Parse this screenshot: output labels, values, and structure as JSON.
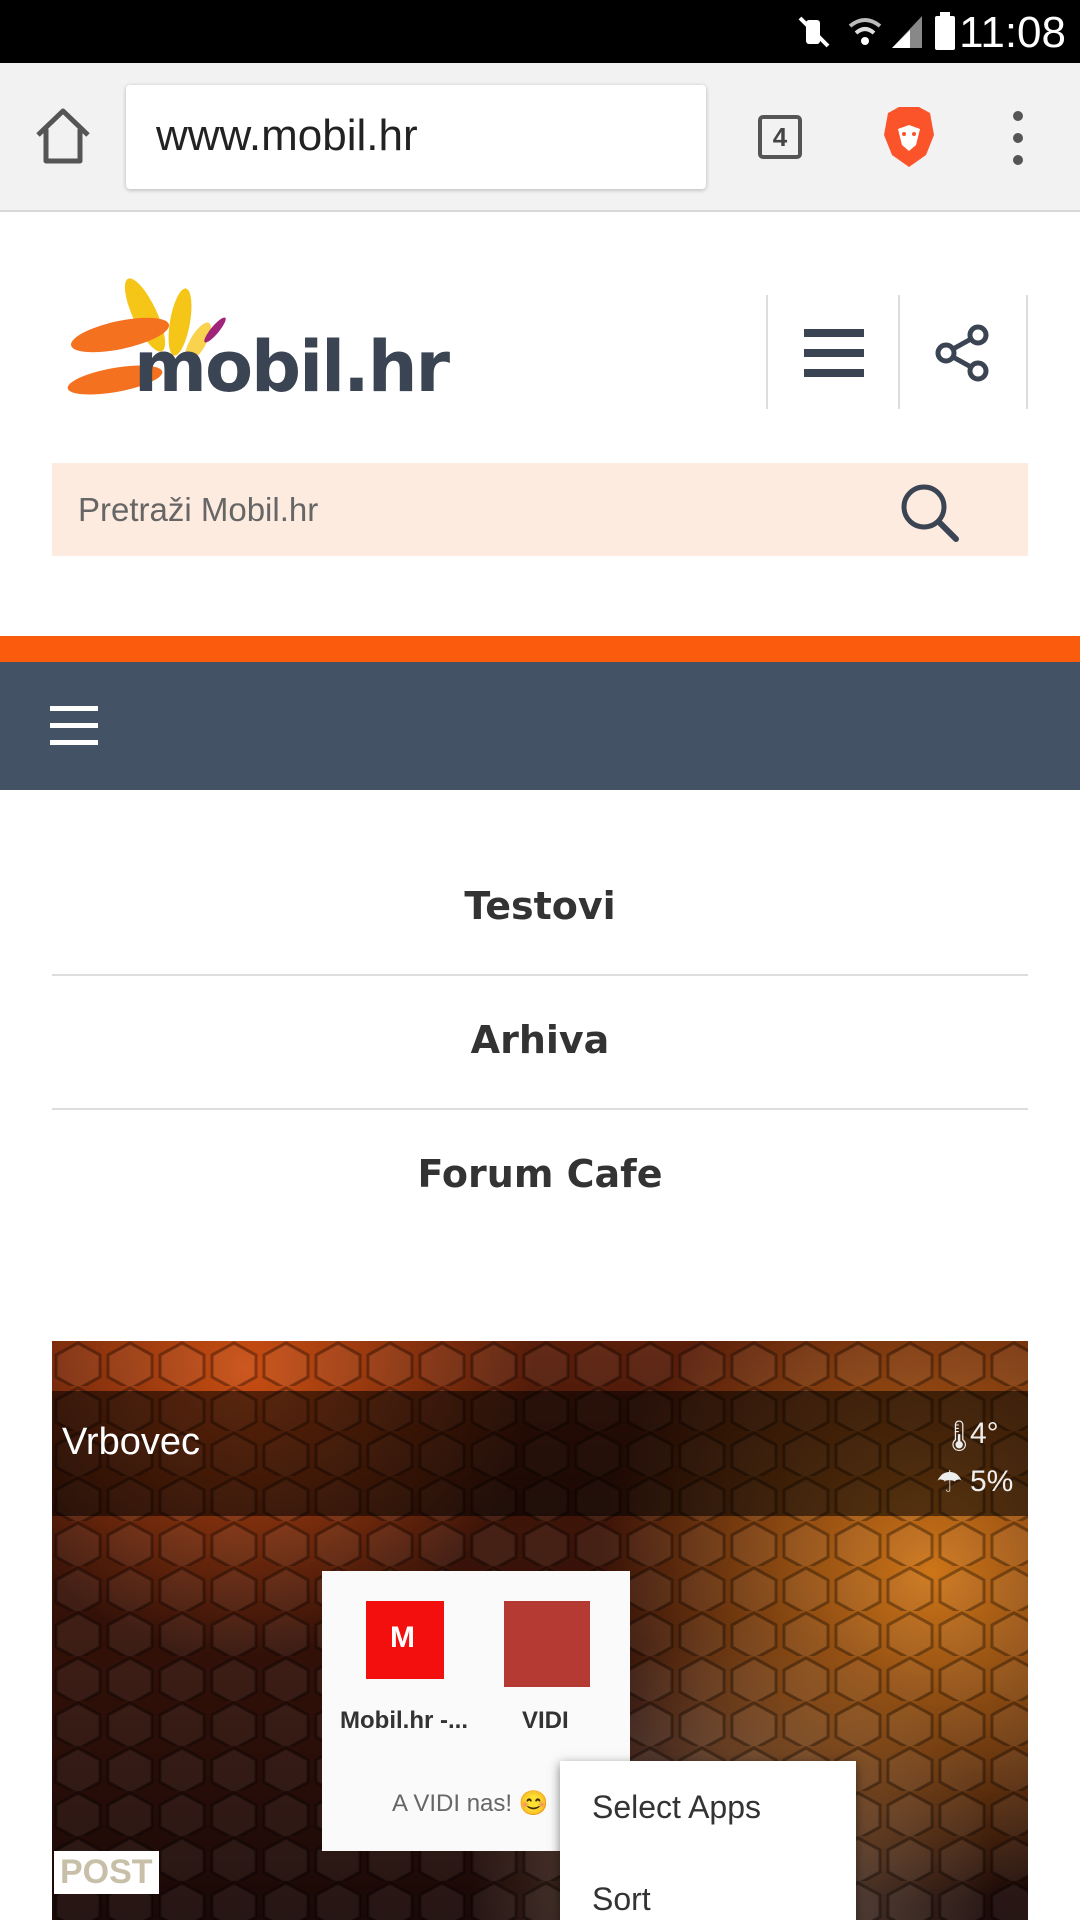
{
  "status_bar": {
    "time": "11:08"
  },
  "browser": {
    "url": "www.mobil.hr",
    "tab_count": "4"
  },
  "site": {
    "logo_text": "mobil.hr",
    "search_placeholder": "Pretraži Mobil.hr",
    "menu": [
      "Testovi",
      "Arhiva",
      "Forum Cafe"
    ]
  },
  "hero": {
    "city": "Vrbovec",
    "temp": "4°",
    "rain": "5%",
    "apps": [
      "Mobil.hr -...",
      "VIDI"
    ],
    "folder_caption": "A VIDI nas! 😊",
    "context_menu": [
      "Select Apps",
      "Sort"
    ],
    "badge": "POST"
  },
  "colors": {
    "accent": "#fb5b0d",
    "nav": "#445265",
    "search_bg": "#fdebe0"
  }
}
